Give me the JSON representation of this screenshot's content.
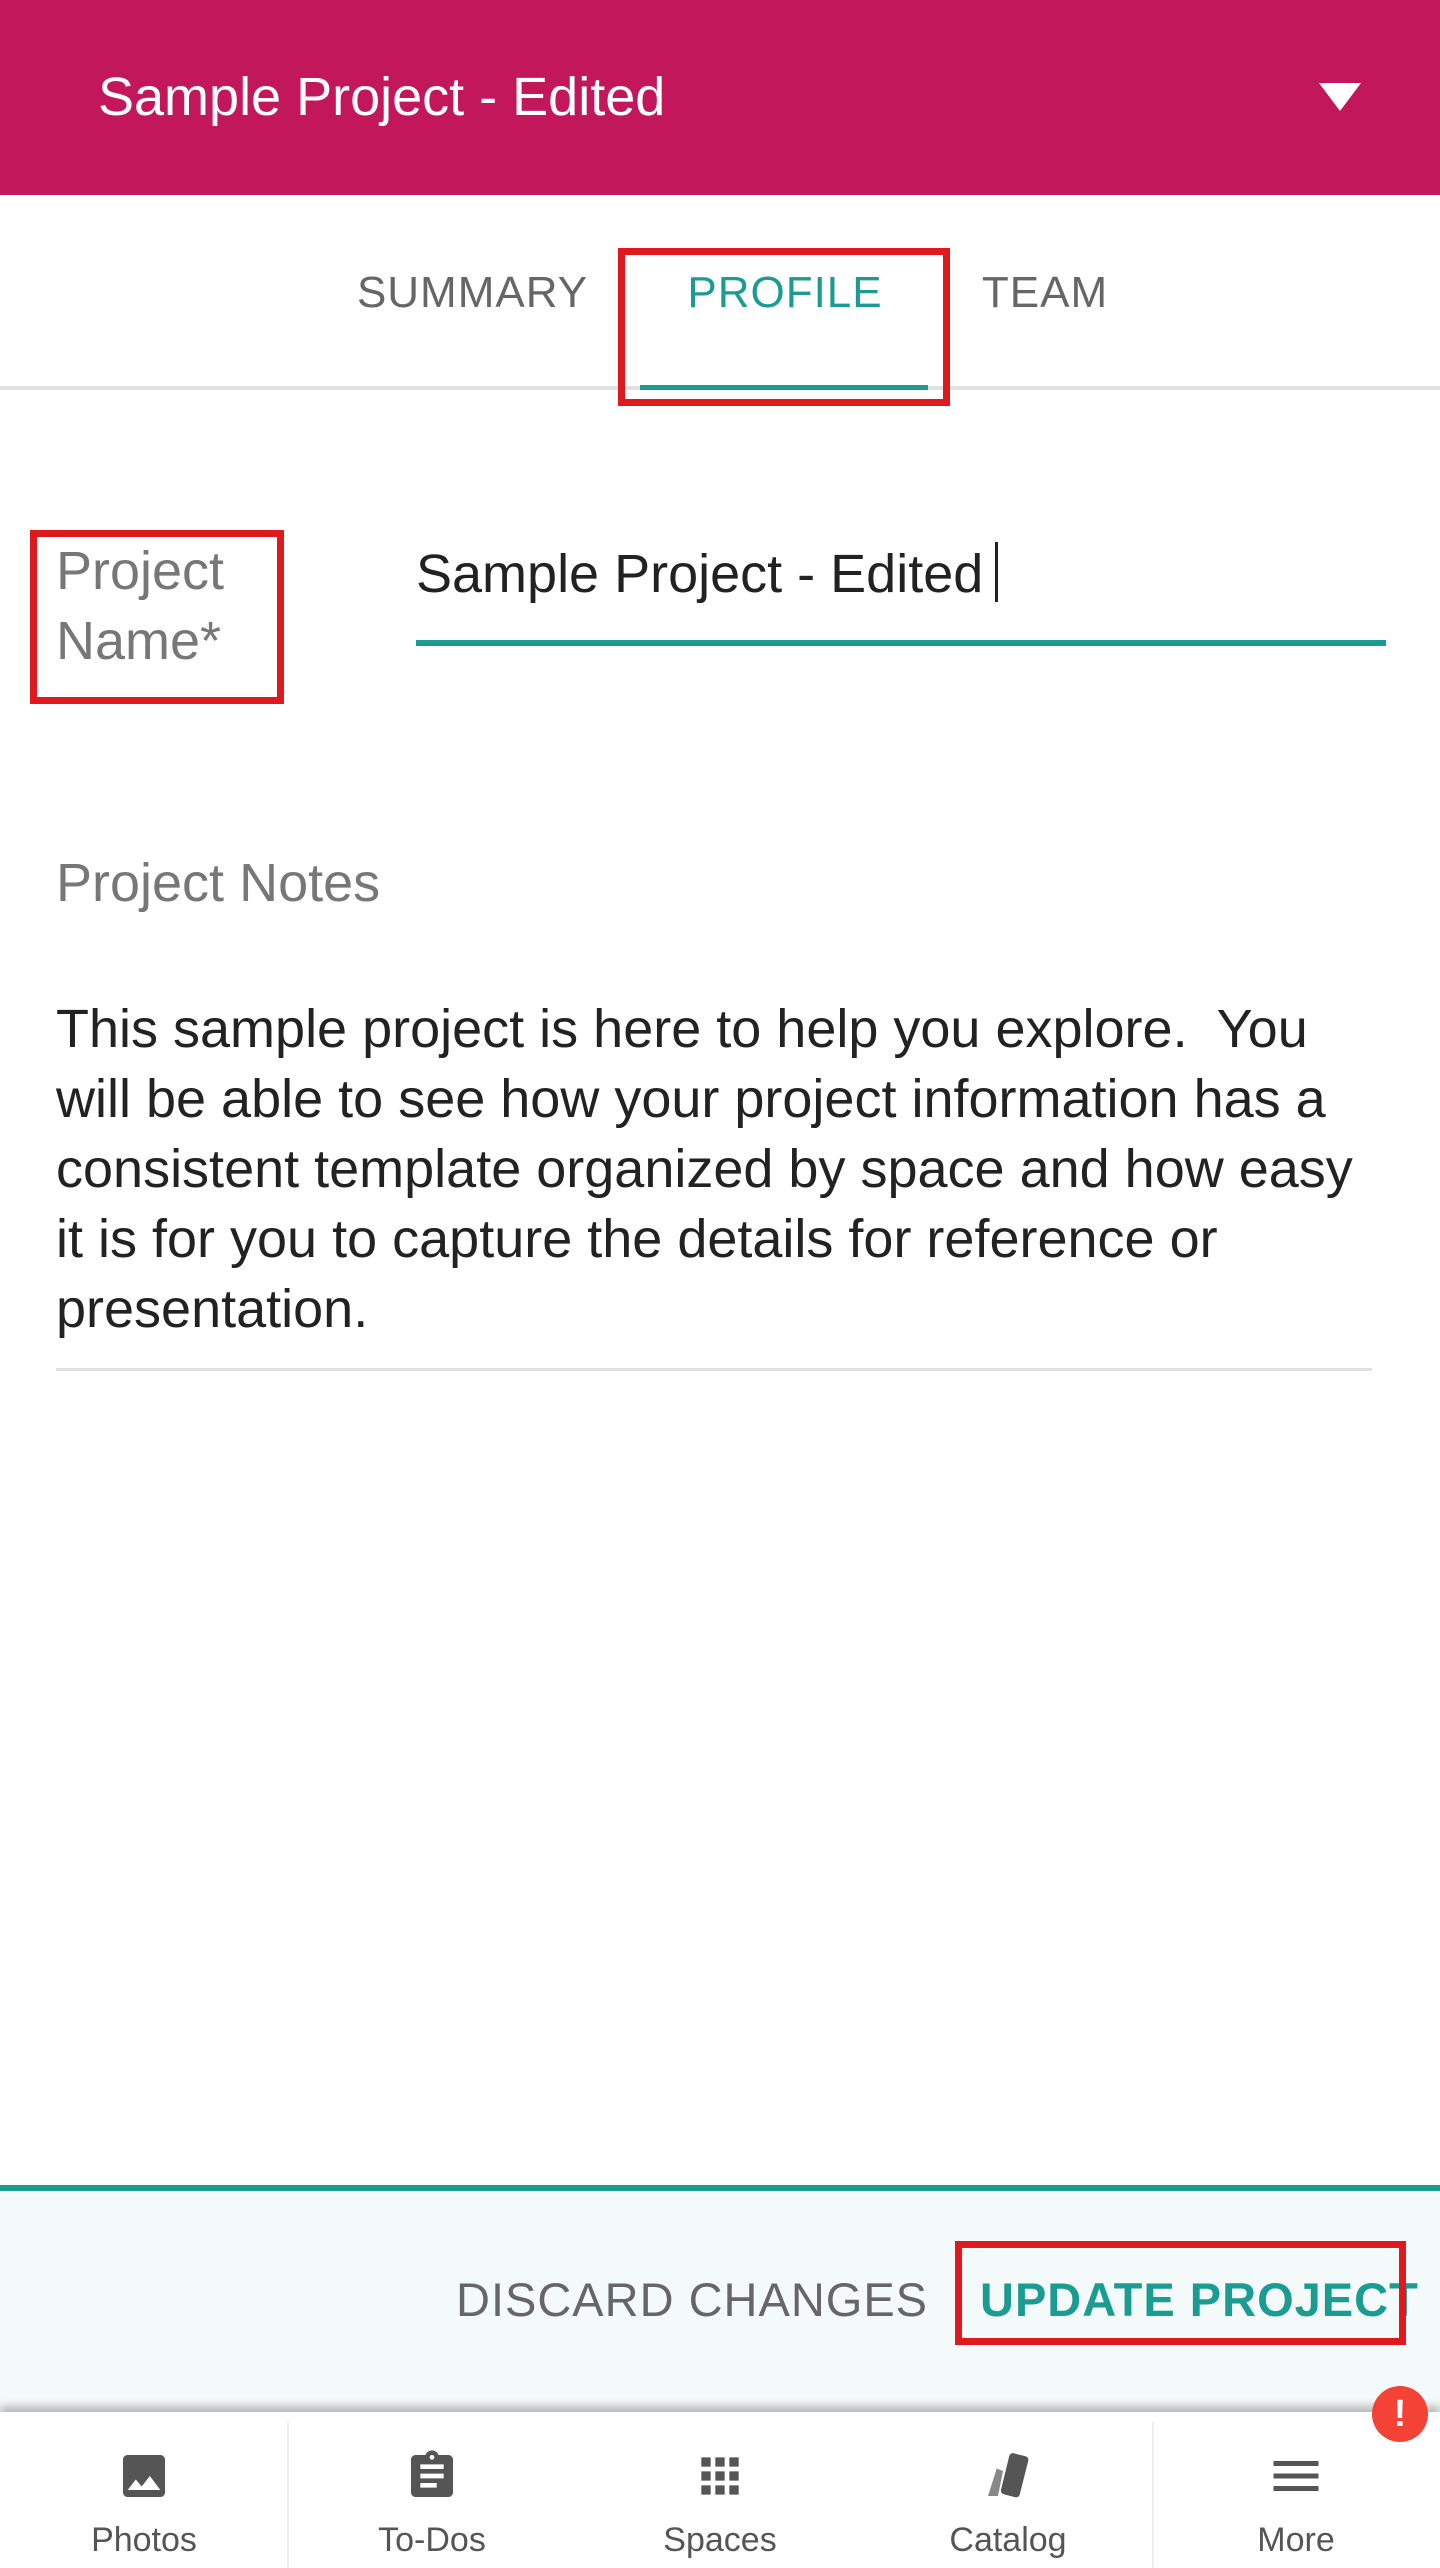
{
  "app_bar": {
    "title": "Sample Project - Edited",
    "dropdown_icon": "triangle-down-icon"
  },
  "tabs": [
    {
      "label": "SUMMARY",
      "active": false
    },
    {
      "label": "PROFILE",
      "active": true
    },
    {
      "label": "TEAM",
      "active": false
    }
  ],
  "form": {
    "project_name": {
      "label": "Project Name*",
      "value": "Sample Project - Edited"
    },
    "project_notes": {
      "label": "Project Notes",
      "value": "This sample project is here to help you explore.  You will be able to see how your project information has a consistent template organized by space and how easy it is for you to capture the details for reference or presentation."
    }
  },
  "actions": {
    "discard_label": "DISCARD CHANGES",
    "update_label": "UPDATE PROJECT"
  },
  "bottom_nav": [
    {
      "label": "Photos",
      "icon": "image-icon"
    },
    {
      "label": "To-Dos",
      "icon": "clipboard-icon"
    },
    {
      "label": "Spaces",
      "icon": "grid-icon"
    },
    {
      "label": "Catalog",
      "icon": "swatch-icon"
    },
    {
      "label": "More",
      "icon": "menu-icon"
    }
  ],
  "alert_badge": "!",
  "colors": {
    "brand": "#c2185b",
    "accent": "#1a9c92",
    "highlight": "#e0191e",
    "alert": "#f44336"
  }
}
